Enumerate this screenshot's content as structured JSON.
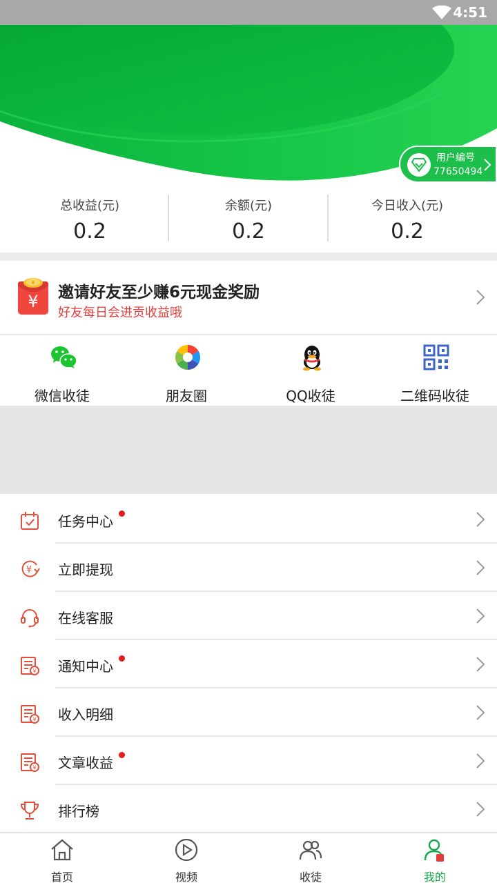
{
  "status_bar": {
    "time": "4:51"
  },
  "user_badge": {
    "label": "用户编号",
    "id": "77650494"
  },
  "stats": [
    {
      "label": "总收益(元)",
      "value": "0.2"
    },
    {
      "label": "余额(元)",
      "value": "0.2"
    },
    {
      "label": "今日收入(元)",
      "value": "0.2"
    }
  ],
  "invite": {
    "title": "邀请好友至少赚6元现金奖励",
    "subtitle": "好友每日会进贡收益哦",
    "envelope_symbol": "¥"
  },
  "share_options": [
    {
      "label": "微信收徒",
      "icon": "wechat-icon"
    },
    {
      "label": "朋友圈",
      "icon": "moments-icon"
    },
    {
      "label": "QQ收徒",
      "icon": "qq-icon"
    },
    {
      "label": "二维码收徒",
      "icon": "qrcode-icon"
    }
  ],
  "menu": [
    {
      "label": "任务中心",
      "icon": "calendar-icon",
      "badge": true
    },
    {
      "label": "立即提现",
      "icon": "withdraw-icon",
      "badge": false
    },
    {
      "label": "在线客服",
      "icon": "headset-icon",
      "badge": false
    },
    {
      "label": "通知中心",
      "icon": "receipt-icon",
      "badge": true
    },
    {
      "label": "收入明细",
      "icon": "receipt-icon",
      "badge": false
    },
    {
      "label": "文章收益",
      "icon": "receipt-icon",
      "badge": true
    },
    {
      "label": "排行榜",
      "icon": "trophy-icon",
      "badge": false
    }
  ],
  "tabs": [
    {
      "label": "首页",
      "icon": "home-icon",
      "active": false
    },
    {
      "label": "视频",
      "icon": "play-icon",
      "active": false
    },
    {
      "label": "收徒",
      "icon": "users-icon",
      "active": false
    },
    {
      "label": "我的",
      "icon": "profile-icon",
      "active": true
    }
  ],
  "colors": {
    "primary_green": "#1bbf4a",
    "accent_red": "#e3413c",
    "menu_icon_red": "#e0503a",
    "badge_red": "#e51b1b",
    "active_tab_green": "#16a84a"
  }
}
